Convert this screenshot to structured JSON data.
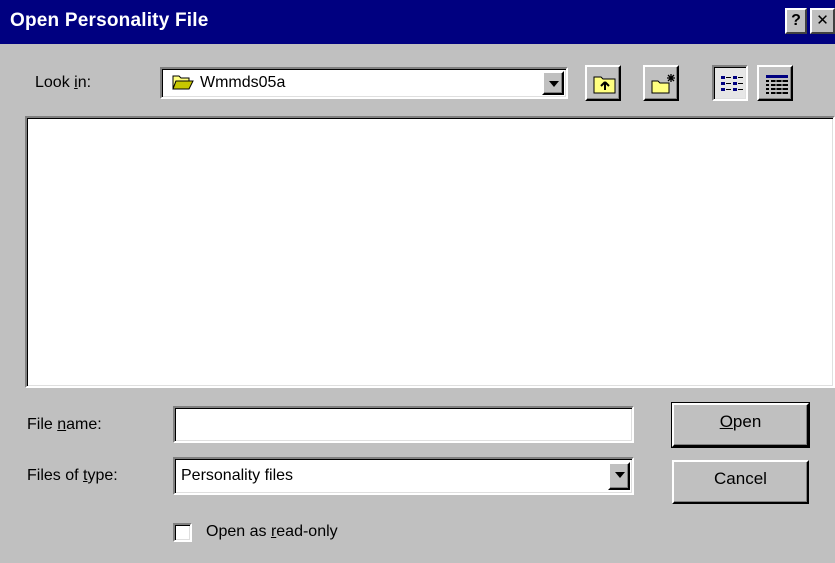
{
  "window": {
    "title": "Open Personality File",
    "help_glyph": "?",
    "close_glyph": "✕"
  },
  "look_in": {
    "label_pre": "Look ",
    "label_key": "i",
    "label_post": "n:",
    "value": "Wmmds05a",
    "folder_icon": "open-folder-icon"
  },
  "toolbar": {
    "buttons": [
      {
        "name": "up-one-level",
        "icon": "up-folder-icon"
      },
      {
        "name": "create-new-folder",
        "icon": "new-folder-icon"
      },
      {
        "name": "list-view",
        "icon": "list-view-icon",
        "pressed": true
      },
      {
        "name": "details-view",
        "icon": "details-view-icon"
      }
    ]
  },
  "file_list": {
    "items": []
  },
  "file_name": {
    "label_pre": "File ",
    "label_key": "n",
    "label_post": "ame:",
    "value": ""
  },
  "file_type": {
    "label_pre": "Files of ",
    "label_key": "t",
    "label_post": "ype:",
    "value": "Personality files"
  },
  "read_only": {
    "label_pre": "Open as ",
    "label_key": "r",
    "label_post": "ead-only",
    "checked": false
  },
  "buttons": {
    "open_key": "O",
    "open_rest": "pen",
    "cancel": "Cancel"
  },
  "colors": {
    "titlebar": "#000080",
    "face": "#c0c0c0",
    "window": "#ffffff"
  }
}
